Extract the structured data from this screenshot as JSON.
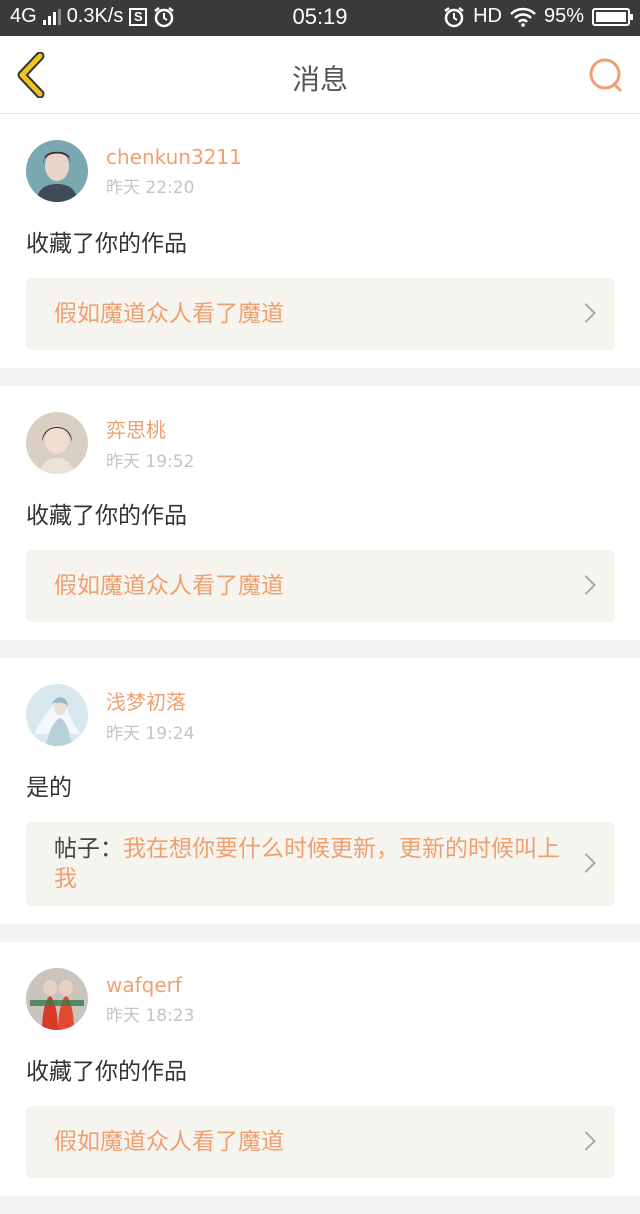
{
  "status_bar": {
    "network": "4G",
    "speed": "0.3K/s",
    "s_badge": "S",
    "time": "05:19",
    "hd": "HD",
    "battery": "95%"
  },
  "header": {
    "title": "消息"
  },
  "messages": [
    {
      "user": "chenkun3211",
      "time": "昨天 22:20",
      "text": "收藏了你的作品",
      "link_prefix": "",
      "link": "假如魔道众人看了魔道"
    },
    {
      "user": "弈思桃",
      "time": "昨天 19:52",
      "text": "收藏了你的作品",
      "link_prefix": "",
      "link": "假如魔道众人看了魔道"
    },
    {
      "user": "浅梦初落",
      "time": "昨天 19:24",
      "text": "是的",
      "link_prefix": "帖子：",
      "link": "我在想你要什么时候更新，更新的时候叫上我"
    },
    {
      "user": "wafqerf",
      "time": "昨天 18:23",
      "text": "收藏了你的作品",
      "link_prefix": "",
      "link": "假如魔道众人看了魔道"
    }
  ],
  "colors": {
    "accent": "#f0a070",
    "back_icon": "#f0c420",
    "status_bar_bg": "#3a3a3a"
  }
}
